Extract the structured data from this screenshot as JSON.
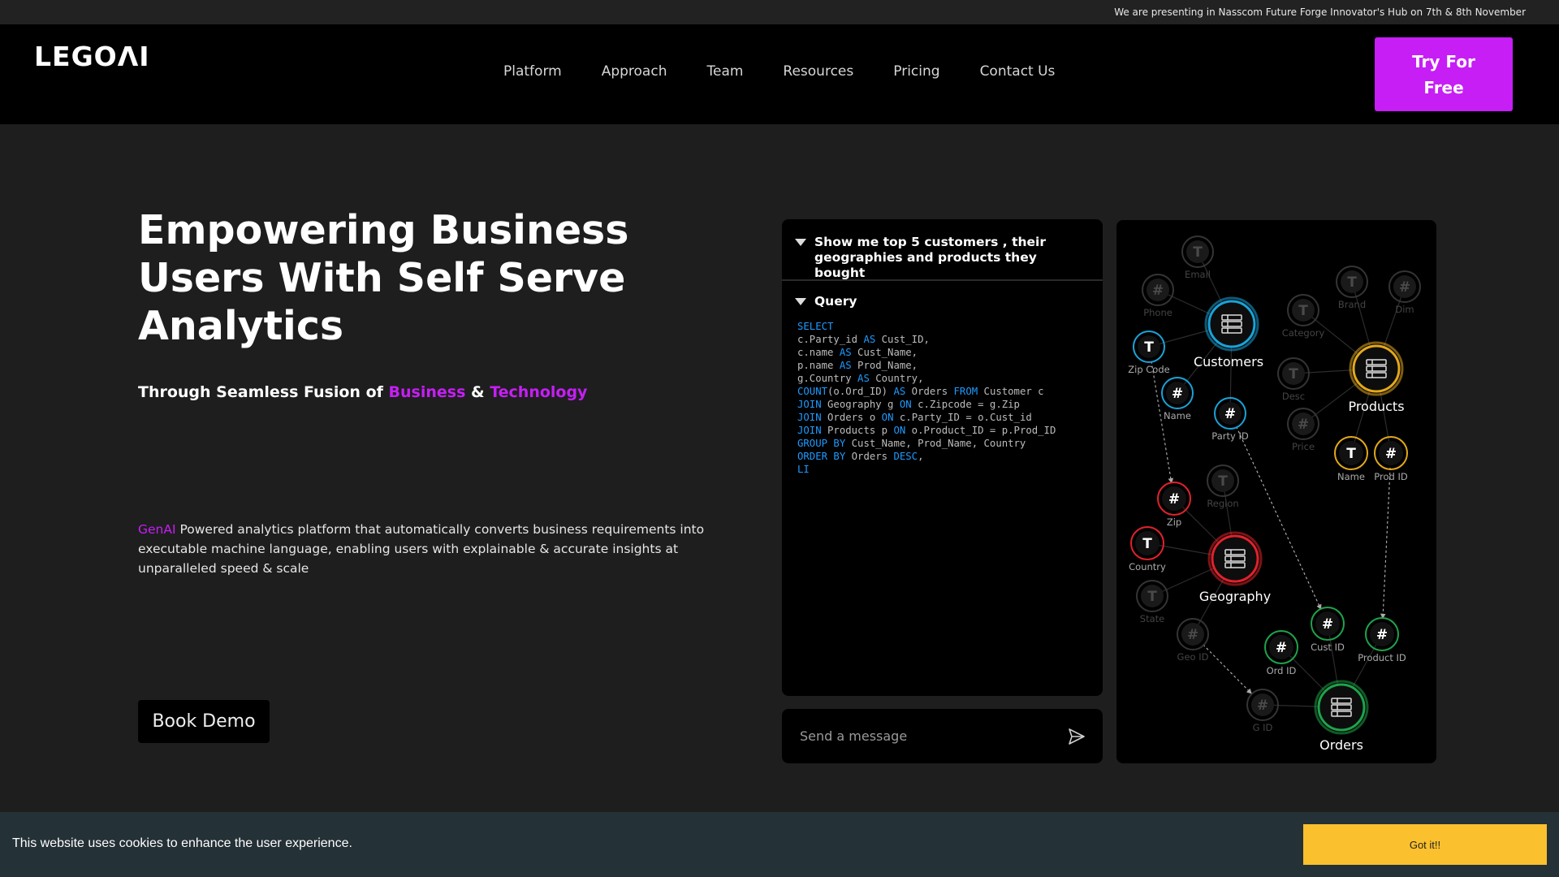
{
  "announcement": "We are presenting in Nasscom Future Forge Innovator's Hub on 7th & 8th November",
  "brand": {
    "logo_text": "LEGOΛI"
  },
  "nav": {
    "items": [
      {
        "label": "Platform"
      },
      {
        "label": "Approach"
      },
      {
        "label": "Team"
      },
      {
        "label": "Resources"
      },
      {
        "label": "Pricing"
      },
      {
        "label": "Contact Us"
      }
    ],
    "cta_label": "Try For Free"
  },
  "hero": {
    "title": "Empowering Business Users With Self Serve Analytics",
    "subtitle_prefix": "Through Seamless Fusion of ",
    "subtitle_highlight_1": "Business",
    "subtitle_amp": " & ",
    "subtitle_highlight_2": "Technology",
    "desc_highlight": "GenAI",
    "desc_rest": " Powered analytics platform that automatically converts business requirements into executable machine language, enabling users with explainable & accurate insights at unparalleled speed & scale",
    "demo_label": "Book Demo"
  },
  "query_panel": {
    "question": "Show me top 5 customers , their geographies and products they bought",
    "query_label": "Query",
    "code_lines": [
      [
        {
          "t": "SELECT",
          "k": 1
        }
      ],
      [
        {
          "t": "c.Party_id "
        },
        {
          "t": "AS",
          "k": 1
        },
        {
          "t": " Cust_ID,"
        }
      ],
      [
        {
          "t": "c.name "
        },
        {
          "t": "AS",
          "k": 1
        },
        {
          "t": " Cust_Name,"
        }
      ],
      [
        {
          "t": "p.name "
        },
        {
          "t": "AS",
          "k": 1
        },
        {
          "t": " Prod_Name,"
        }
      ],
      [
        {
          "t": "g.Country "
        },
        {
          "t": "AS",
          "k": 1
        },
        {
          "t": " Country,"
        }
      ],
      [
        {
          "t": "COUNT",
          "k": 1
        },
        {
          "t": "(o.Ord_ID) "
        },
        {
          "t": "AS",
          "k": 1
        },
        {
          "t": " Orders "
        },
        {
          "t": "FROM",
          "k": 1
        },
        {
          "t": " Customer c"
        }
      ],
      [
        {
          "t": "JOIN",
          "k": 1
        },
        {
          "t": " Geography g "
        },
        {
          "t": "ON",
          "k": 1
        },
        {
          "t": " c.Zipcode = g.Zip"
        }
      ],
      [
        {
          "t": "JOIN",
          "k": 1
        },
        {
          "t": " Orders o "
        },
        {
          "t": "ON",
          "k": 1
        },
        {
          "t": " c.Party_ID = o.Cust_id"
        }
      ],
      [
        {
          "t": "JOIN",
          "k": 1
        },
        {
          "t": " Products p "
        },
        {
          "t": "ON",
          "k": 1
        },
        {
          "t": " o.Product_ID = p.Prod_ID"
        }
      ],
      [
        {
          "t": "GROUP BY",
          "k": 1
        },
        {
          "t": " Cust_Name, Prod_Name, Country"
        }
      ],
      [
        {
          "t": "ORDER BY",
          "k": 1
        },
        {
          "t": " Orders "
        },
        {
          "t": "DESC",
          "k": 1
        },
        {
          "t": ","
        }
      ],
      [
        {
          "t": "LI",
          "k": 1
        }
      ]
    ]
  },
  "message": {
    "placeholder": "Send a message"
  },
  "graph": {
    "colors": {
      "cyan": "#1aa3d9",
      "yellow": "#e3a81c",
      "red": "#e0222c",
      "green": "#1ea34a",
      "gray": "#3a3a3a"
    },
    "entities": [
      {
        "label": "Customers",
        "color": "cyan"
      },
      {
        "label": "Products",
        "color": "yellow"
      },
      {
        "label": "Geography",
        "color": "red"
      },
      {
        "label": "Orders",
        "color": "green"
      }
    ],
    "fields": [
      {
        "label": "Email",
        "glyph": "T",
        "color": "gray"
      },
      {
        "label": "Phone",
        "glyph": "#",
        "color": "gray"
      },
      {
        "label": "Zip Code",
        "glyph": "T",
        "color": "cyan"
      },
      {
        "label": "Name",
        "glyph": "#",
        "color": "cyan"
      },
      {
        "label": "Party ID",
        "glyph": "#",
        "color": "cyan"
      },
      {
        "label": "Category",
        "glyph": "T",
        "color": "gray"
      },
      {
        "label": "Brand",
        "glyph": "T",
        "color": "gray"
      },
      {
        "label": "Dim",
        "glyph": "#",
        "color": "gray"
      },
      {
        "label": "Desc",
        "glyph": "T",
        "color": "gray"
      },
      {
        "label": "Price",
        "glyph": "#",
        "color": "gray"
      },
      {
        "label": "Name",
        "glyph": "T",
        "color": "yellow"
      },
      {
        "label": "Prod ID",
        "glyph": "#",
        "color": "yellow"
      },
      {
        "label": "Zip",
        "glyph": "#",
        "color": "red"
      },
      {
        "label": "Region",
        "glyph": "T",
        "color": "gray"
      },
      {
        "label": "Country",
        "glyph": "T",
        "color": "red"
      },
      {
        "label": "State",
        "glyph": "T",
        "color": "gray"
      },
      {
        "label": "Geo ID",
        "glyph": "#",
        "color": "gray"
      },
      {
        "label": "Cust ID",
        "glyph": "#",
        "color": "green"
      },
      {
        "label": "Product ID",
        "glyph": "#",
        "color": "green"
      },
      {
        "label": "Ord ID",
        "glyph": "#",
        "color": "green"
      },
      {
        "label": "G ID",
        "glyph": "#",
        "color": "gray"
      }
    ]
  },
  "cookie": {
    "text": "This website uses cookies to enhance the user experience.",
    "button_label": "Got it!!"
  }
}
